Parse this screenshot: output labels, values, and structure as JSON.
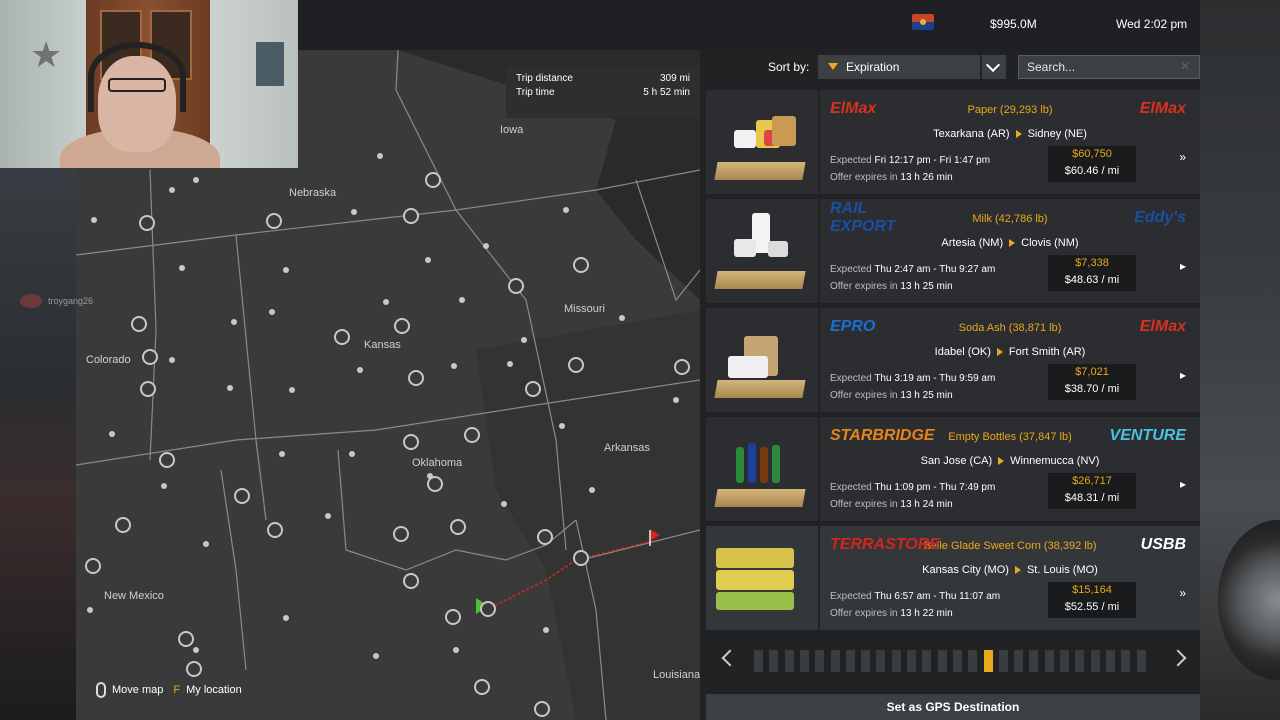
{
  "status": {
    "money": "$995.0M",
    "datetime": "Wed 2:02 pm",
    "state_flag": "arizona-flag-icon"
  },
  "map": {
    "labels": {
      "iowa": "Iowa",
      "nebraska": "Nebraska",
      "missouri": "Missouri",
      "colorado": "Colorado",
      "kansas": "Kansas",
      "arkansas": "Arkansas",
      "oklahoma": "Oklahoma",
      "new_mexico": "New Mexico",
      "louisiana": "Louisiana"
    },
    "trip": {
      "distance_label": "Trip distance",
      "distance_value": "309 mi",
      "time_label": "Trip time",
      "time_value": "5 h 52 min"
    },
    "hints": {
      "move_label": "Move map",
      "location_key": "F",
      "location_label": "My location"
    }
  },
  "chat_overlay": {
    "username": "troygang26"
  },
  "jobs_panel": {
    "sort_label": "Sort by:",
    "sort_value": "Expiration",
    "search_placeholder": "Search...",
    "gps_button": "Set as GPS Destination",
    "pager": {
      "total_pages": 26,
      "current_page": 16
    },
    "jobs": [
      {
        "source_logo": "ElMax",
        "dest_logo": "ElMax",
        "cargo": "Paper (29,293 lb)",
        "origin": "Texarkana (AR)",
        "destination": "Sidney (NE)",
        "expected_label": "Expected",
        "expected": "Fri 12:17 pm - Fri 1:47 pm",
        "offer_label": "Offer expires in",
        "offer": "13 h 26 min",
        "pay": "$60,750",
        "per_mile": "$60.46 / mi",
        "action_icon": "double-chevron-icon"
      },
      {
        "source_logo": "RAIL EXPORT",
        "dest_logo": "Eddy's",
        "cargo": "Milk (42,786 lb)",
        "origin": "Artesia (NM)",
        "destination": "Clovis (NM)",
        "expected_label": "Expected",
        "expected": "Thu 2:47 am - Thu 9:27 am",
        "offer_label": "Offer expires in",
        "offer": "13 h 25 min",
        "pay": "$7,338",
        "per_mile": "$48.63 / mi",
        "action_icon": "chevron-right-icon"
      },
      {
        "source_logo": "EPRO",
        "dest_logo": "ElMax",
        "cargo": "Soda Ash (38,871 lb)",
        "origin": "Idabel (OK)",
        "destination": "Fort Smith (AR)",
        "expected_label": "Expected",
        "expected": "Thu 3:19 am - Thu 9:59 am",
        "offer_label": "Offer expires in",
        "offer": "13 h 25 min",
        "pay": "$7,021",
        "per_mile": "$38.70 / mi",
        "action_icon": "chevron-right-icon"
      },
      {
        "source_logo": "STARBRIDGE",
        "dest_logo": "VENTURE",
        "cargo": "Empty Bottles (37,847 lb)",
        "origin": "San Jose (CA)",
        "destination": "Winnemucca (NV)",
        "expected_label": "Expected",
        "expected": "Thu 1:09 pm - Thu 7:49 pm",
        "offer_label": "Offer expires in",
        "offer": "13 h 24 min",
        "pay": "$26,717",
        "per_mile": "$48.31 / mi",
        "action_icon": "chevron-right-icon"
      },
      {
        "source_logo": "TERRASTORE",
        "dest_logo": "USBB",
        "cargo": "Belle Glade Sweet Corn (38,392 lb)",
        "origin": "Kansas City (MO)",
        "destination": "St. Louis (MO)",
        "expected_label": "Expected",
        "expected": "Thu 6:57 am - Thu 11:07 am",
        "offer_label": "Offer expires in",
        "offer": "13 h 22 min",
        "pay": "$15,164",
        "per_mile": "$52.55 / mi",
        "action_icon": "double-chevron-icon"
      }
    ]
  }
}
